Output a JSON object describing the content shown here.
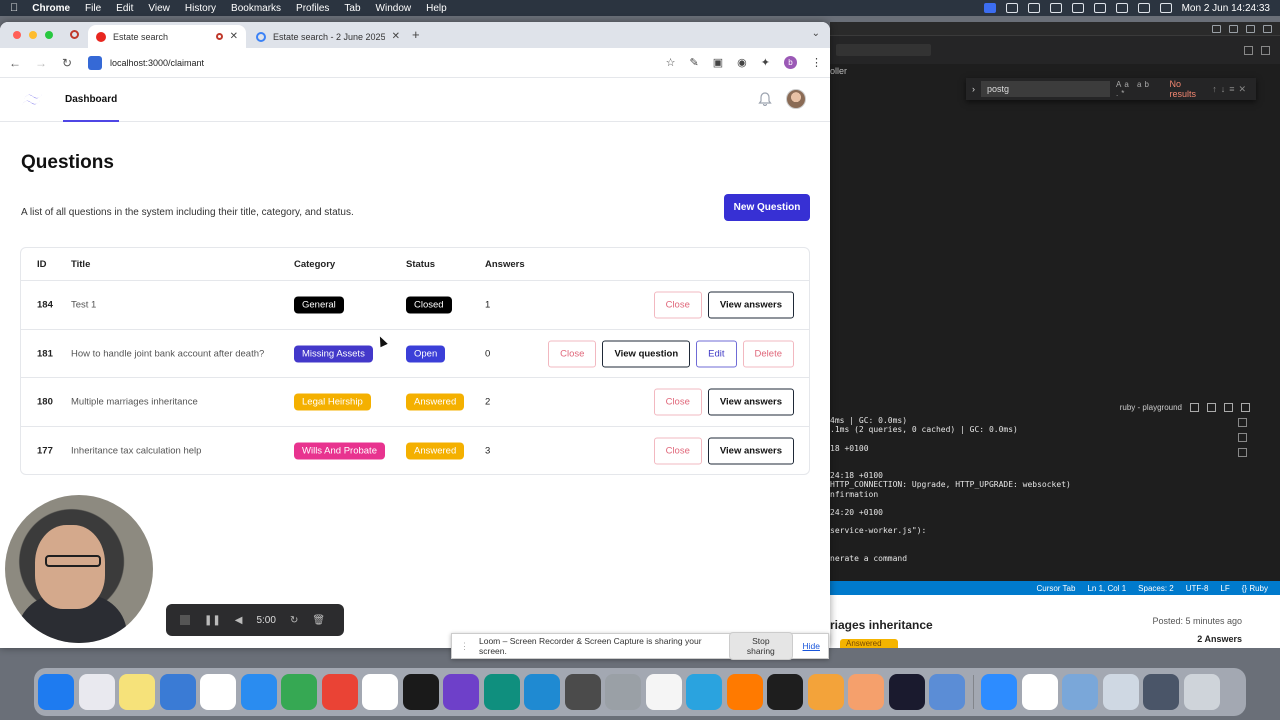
{
  "menubar": {
    "app": "Chrome",
    "items": [
      "File",
      "Edit",
      "View",
      "History",
      "Bookmarks",
      "Profiles",
      "Tab",
      "Window",
      "Help"
    ],
    "clock": "Mon 2 Jun  14:24:33"
  },
  "browser": {
    "tabs": [
      {
        "title": "Estate search"
      },
      {
        "title": "Estate search - 2 June 2025"
      }
    ],
    "url": "localhost:3000/claimant",
    "profile_initial": "b"
  },
  "app": {
    "nav": {
      "dashboard": "Dashboard"
    },
    "page_title": "Questions",
    "description": "A list of all questions in the system including their title, category, and status.",
    "new_button": "New Question",
    "columns": {
      "id": "ID",
      "title": "Title",
      "category": "Category",
      "status": "Status",
      "answers": "Answers"
    },
    "rows": [
      {
        "id": "184",
        "title": "Test 1",
        "category": "General",
        "category_color": "#000000",
        "status": "Closed",
        "status_color": "#000000",
        "answers": "1",
        "actions": [
          "Close",
          "View answers"
        ]
      },
      {
        "id": "181",
        "title": "How to handle joint bank account after death?",
        "category": "Missing Assets",
        "category_color": "#4338ca",
        "status": "Open",
        "status_color": "#3b3fd8",
        "answers": "0",
        "actions": [
          "Close",
          "View question",
          "Edit",
          "Delete"
        ]
      },
      {
        "id": "180",
        "title": "Multiple marriages inheritance",
        "category": "Legal Heirship",
        "category_color": "#f4b000",
        "status": "Answered",
        "status_color": "#f4b000",
        "answers": "2",
        "actions": [
          "Close",
          "View answers"
        ]
      },
      {
        "id": "177",
        "title": "Inheritance tax calculation help",
        "category": "Wills And Probate",
        "category_color": "#e8338f",
        "status": "Answered",
        "status_color": "#f4b000",
        "answers": "3",
        "actions": [
          "Close",
          "View answers"
        ]
      }
    ]
  },
  "editor": {
    "find_query": "postg",
    "find_result": "No results",
    "crumb": "oller",
    "terminal_title": "ruby - playground",
    "terminal_lines": [
      "4ms | GC: 0.0ms)",
      ".1ms (2 queries, 0 cached) | GC: 0.0ms)",
      "",
      "18 +0100",
      "",
      "",
      "24:18 +0100",
      "HTTP_CONNECTION: Upgrade, HTTP_UPGRADE: websocket)",
      "nfirmation",
      "",
      "24:20 +0100",
      "",
      "service-worker.js\"):",
      "",
      "",
      "nerate a command"
    ],
    "status": [
      "Cursor Tab",
      "Ln 1, Col 1",
      "Spaces: 2",
      "UTF-8",
      "LF",
      "{} Ruby"
    ],
    "lower_title": "riages inheritance",
    "lower_posted": "Posted: 5 minutes ago",
    "lower_answers": "2 Answers",
    "lower_badge": "Answered"
  },
  "loom": {
    "timer": "5:00",
    "share_text": "Loom – Screen Recorder & Screen Capture is sharing your screen.",
    "stop": "Stop sharing",
    "hide": "Hide"
  },
  "dock_icons": [
    "finder-icon",
    "launchpad-icon",
    "notes-icon",
    "freeform-icon",
    "calendar-icon",
    "safari-icon",
    "numbers-icon",
    "chrome-icon",
    "notion-icon",
    "cursor-icon",
    "github-desktop-icon",
    "chatgpt-icon",
    "vscode-icon",
    "calculator-icon",
    "settings-icon",
    "ai-app-icon",
    "telegram-icon",
    "sublime-icon",
    "figma-icon",
    "balance-icon",
    "claude-icon",
    "bar-chart-icon",
    "preview-icon",
    "zoom-icon",
    "document-icon",
    "screenshot-icon",
    "screenshot-icon-2",
    "screenshot-icon-3",
    "trash-icon"
  ],
  "dock_colors": [
    "#1e7bf0",
    "#e9e9ef",
    "#f6e27a",
    "#3a7bd5",
    "#ffffff",
    "#2a8cf0",
    "#36a853",
    "#ea4335",
    "#ffffff",
    "#1a1a1a",
    "#6e40c9",
    "#0f8f7e",
    "#1f8ad2",
    "#4b4b4b",
    "#9aa0a6",
    "#f5f5f5",
    "#2aa3df",
    "#ff7a00",
    "#1e1e1e",
    "#f3a33a",
    "#f5a06c",
    "#1a1a2e",
    "#5b8dd6",
    "#2d8cff",
    "#ffffff",
    "#7aa7d9",
    "#cfd8e3",
    "#4a5568",
    "#cfd4da"
  ]
}
